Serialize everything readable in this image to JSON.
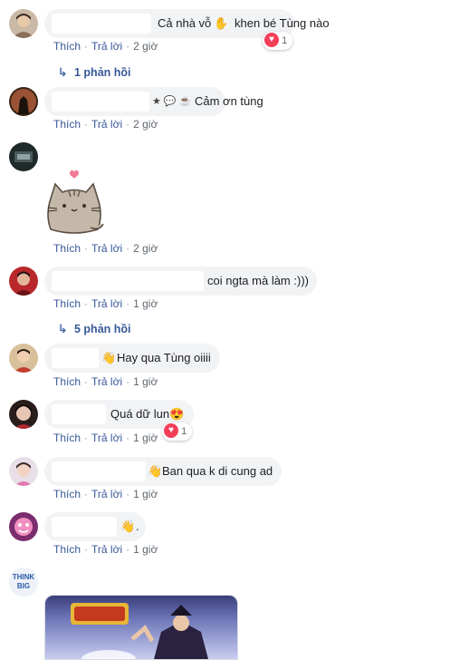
{
  "comments": [
    {
      "text": "Cả nhà vỗ",
      "text_after_emoji": "khen bé Tùng nào",
      "emoji": "✋",
      "like_label": "Thích",
      "reply_label": "Trả lời",
      "time": "2 giờ",
      "reaction_count": "1",
      "replies_label": "1 phản hồi"
    },
    {
      "emoji_prefix": "★ 💬 ☕",
      "text": "Cảm ơn tùng",
      "like_label": "Thích",
      "reply_label": "Trả lời",
      "time": "2 giờ"
    },
    {
      "sticker": "pusheen-cat-heart",
      "like_label": "Thích",
      "reply_label": "Trả lời",
      "time": "2 giờ"
    },
    {
      "text": "coi ngta mà làm :)))",
      "like_label": "Thích",
      "reply_label": "Trả lời",
      "time": "1 giờ",
      "replies_label": "5 phản hồi"
    },
    {
      "emoji": "👋",
      "text": "Hay qua Tùng oiiii",
      "like_label": "Thích",
      "reply_label": "Trả lời",
      "time": "1 giờ"
    },
    {
      "text": "Quá dữ lun",
      "emoji": "😍",
      "like_label": "Thích",
      "reply_label": "Trả lời",
      "time": "1 giờ",
      "reaction_count": "1"
    },
    {
      "emoji": "👋",
      "text": "Ban qua k di cung ad",
      "like_label": "Thích",
      "reply_label": "Trả lời",
      "time": "1 giờ"
    },
    {
      "emoji": "👋",
      "text": ".",
      "like_label": "Thích",
      "reply_label": "Trả lời",
      "time": "1 giờ"
    },
    {
      "avatar_text": "THINK BIG",
      "image": "game-promo-image"
    }
  ],
  "colors": {
    "bubble": "#f2f3f5",
    "link": "#385898",
    "meta": "#606770",
    "heart": "#f33e58"
  }
}
